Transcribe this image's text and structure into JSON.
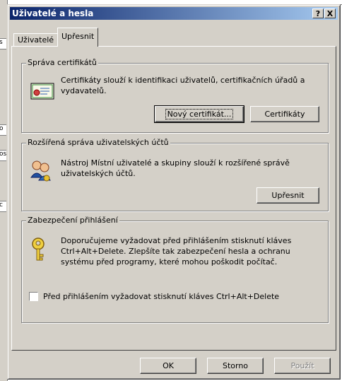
{
  "window": {
    "title": "Uživatelé a hesla",
    "help_glyph": "?",
    "close_glyph": "X"
  },
  "tabs": [
    {
      "label": "Uživatelé",
      "active": false
    },
    {
      "label": "Upřesnit",
      "active": true
    }
  ],
  "certificates": {
    "legend": "Správa certifikátů",
    "text_line1": "Certifikáty slouží k identifikaci uživatelů, certifikačních úřadů a",
    "text_line2": "vydavatelů.",
    "new_cert_button": "Nový certifikát...",
    "certs_button": "Certifikáty",
    "icon": "certificate-icon"
  },
  "user_management": {
    "legend": "Rozšířená správa uživatelských účtů",
    "text_line1": "Nástroj Místní uživatelé a skupiny slouží k rozšířené správě",
    "text_line2": "uživatelských účtů.",
    "advanced_button": "Upřesnit",
    "icon": "users-key-icon"
  },
  "login_security": {
    "legend": "Zabezpečení přihlášení",
    "text_line1": "Doporučujeme vyžadovat před přihlášením stisknutí kláves",
    "text_line2": "Ctrl+Alt+Delete. Zlepšíte tak zabezpečení hesla a ochranu",
    "text_line3": "systému před programy, které mohou poškodit počítač.",
    "checkbox_label": "Před přihlášením vyžadovat stisknutí kláves Ctrl+Alt+Delete",
    "checkbox_checked": false,
    "icon": "key-icon"
  },
  "footer": {
    "ok": "OK",
    "cancel": "Storno",
    "apply": "Použít"
  },
  "background_fragments": [
    "s",
    "o",
    "os",
    "c"
  ]
}
